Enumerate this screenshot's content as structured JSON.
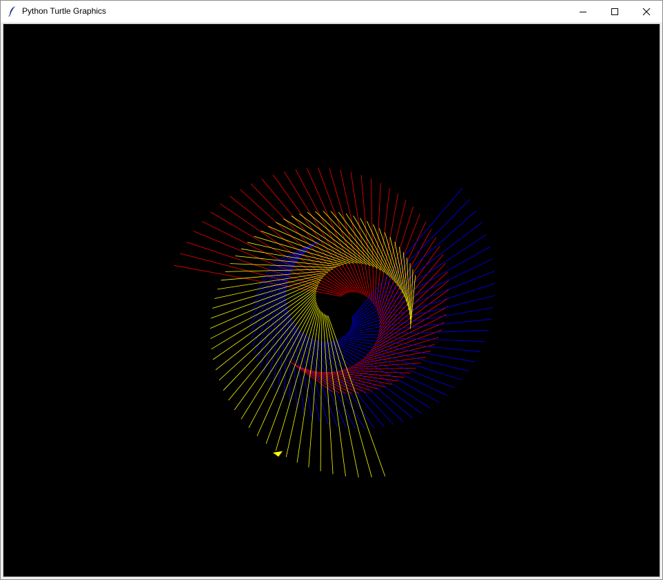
{
  "window": {
    "title": "Python Turtle Graphics",
    "controls": {
      "minimize": "minimize-icon",
      "maximize": "maximize-icon",
      "close": "close-icon"
    }
  },
  "canvas": {
    "background": "#000000",
    "turtle_color": "#ffff00",
    "spiral_colors": {
      "red": "#ff0000",
      "blue": "#0000ff",
      "yellow": "#ffff00"
    }
  }
}
